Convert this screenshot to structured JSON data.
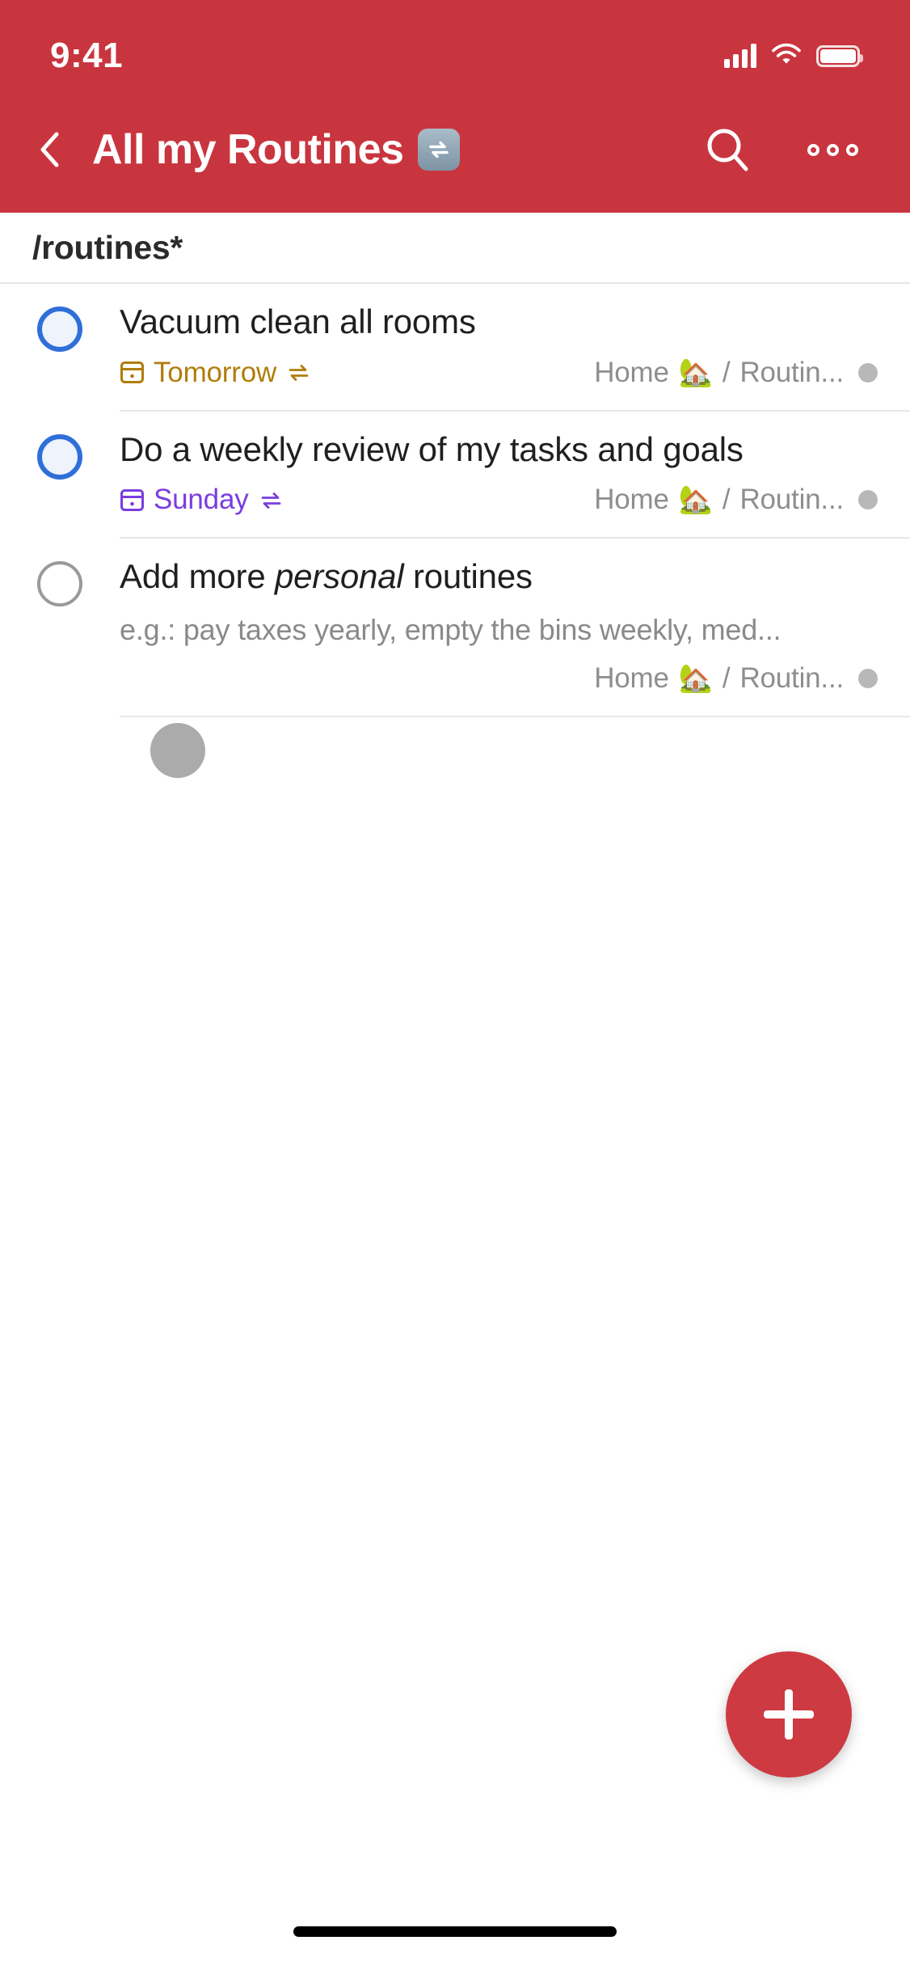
{
  "status_bar": {
    "time": "9:41",
    "cellular_icon": "cellular-signal-icon",
    "wifi_icon": "wifi-icon",
    "battery_icon": "battery-full-icon"
  },
  "header": {
    "background_color": "#c9353f",
    "back_icon": "back-chevron-icon",
    "title": "All my Routines",
    "title_badge_icon": "repeat-emoji-badge",
    "title_badge_glyph": "🔁",
    "search_icon": "search-icon",
    "overflow_icon": "more-options-icon"
  },
  "breadcrumb": {
    "text": "/routines*"
  },
  "tasks": [
    {
      "checkbox_state": "unchecked",
      "checkbox_style": "priority-blue",
      "title": "Vacuum clean all rooms",
      "title_italic_part": "",
      "description": "",
      "due": {
        "label": "Tomorrow",
        "color": "#b07d0a",
        "calendar_icon": "calendar-icon",
        "recurring_icon": "recurring-icon"
      },
      "project": {
        "name": "Home",
        "emoji": "🏡",
        "separator": "/",
        "sub": "Routin...",
        "dot_color": "#b8b8b8"
      }
    },
    {
      "checkbox_state": "unchecked",
      "checkbox_style": "priority-blue",
      "title": "Do a weekly review of my tasks and goals",
      "title_italic_part": "",
      "description": "",
      "due": {
        "label": "Sunday",
        "color": "#7a3de0",
        "calendar_icon": "calendar-icon",
        "recurring_icon": "recurring-icon"
      },
      "project": {
        "name": "Home",
        "emoji": "🏡",
        "separator": "/",
        "sub": "Routin...",
        "dot_color": "#b8b8b8"
      }
    },
    {
      "checkbox_state": "unchecked",
      "checkbox_style": "plain-gray",
      "title_prefix": "Add more ",
      "title_italic_part": "personal",
      "title_suffix": " routines",
      "description": "e.g.: pay taxes yearly, empty the bins weekly, med...",
      "due": null,
      "project": {
        "name": "Home",
        "emoji": "🏡",
        "separator": "/",
        "sub": "Routin...",
        "dot_color": "#b8b8b8"
      }
    }
  ],
  "fab": {
    "icon": "plus-icon",
    "background_color": "#ce3a42"
  },
  "home_indicator": {
    "present": true
  }
}
